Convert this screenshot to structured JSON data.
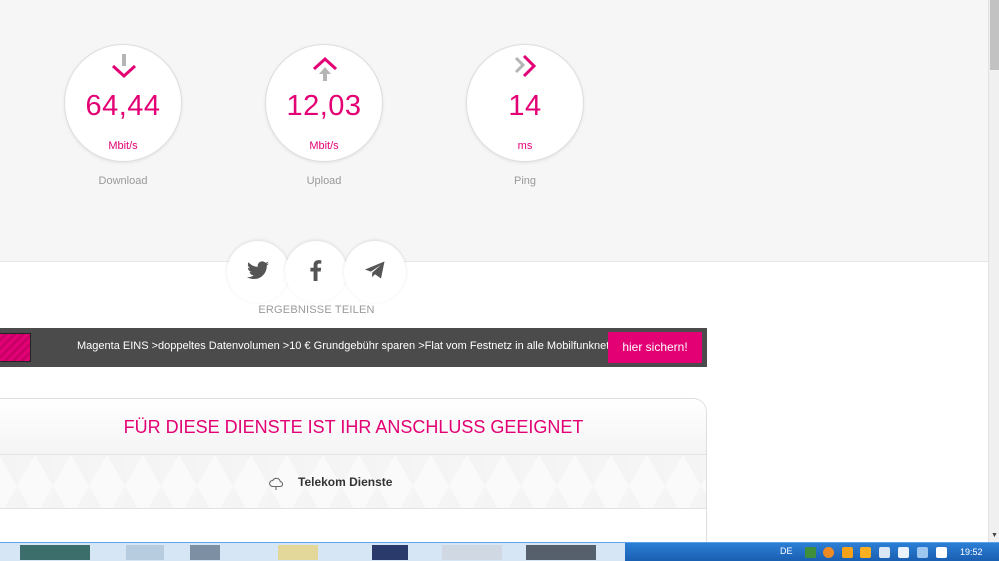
{
  "speedtest": {
    "download": {
      "value": "64,44",
      "unit": "Mbit/s",
      "label": "Download",
      "icon": "arrow-down-icon"
    },
    "upload": {
      "value": "12,03",
      "unit": "Mbit/s",
      "label": "Upload",
      "icon": "arrow-up-icon"
    },
    "ping": {
      "value": "14",
      "unit": "ms",
      "label": "Ping",
      "icon": "chevron-right-double-icon"
    }
  },
  "share": {
    "label": "ERGEBNISSE TEILEN",
    "buttons": [
      "twitter-icon",
      "facebook-icon",
      "telegram-icon"
    ]
  },
  "promo": {
    "text": "Magenta EINS >doppeltes Datenvolumen >10 € Grundgebühr sparen >Flat vom Festnetz in alle Mobilfunknetze",
    "cta": "hier sichern!"
  },
  "services": {
    "title": "FÜR DIESE DIENSTE IST IHR ANSCHLUSS GEEIGNET",
    "rows": [
      {
        "label": "Telekom Dienste",
        "icon": "cloud-icon"
      }
    ]
  },
  "taskbar": {
    "language": "DE",
    "clock": "19:52"
  },
  "colors": {
    "accent": "#e20074",
    "muted": "#9a9a9a",
    "promo_bg": "#4b4b4b"
  }
}
